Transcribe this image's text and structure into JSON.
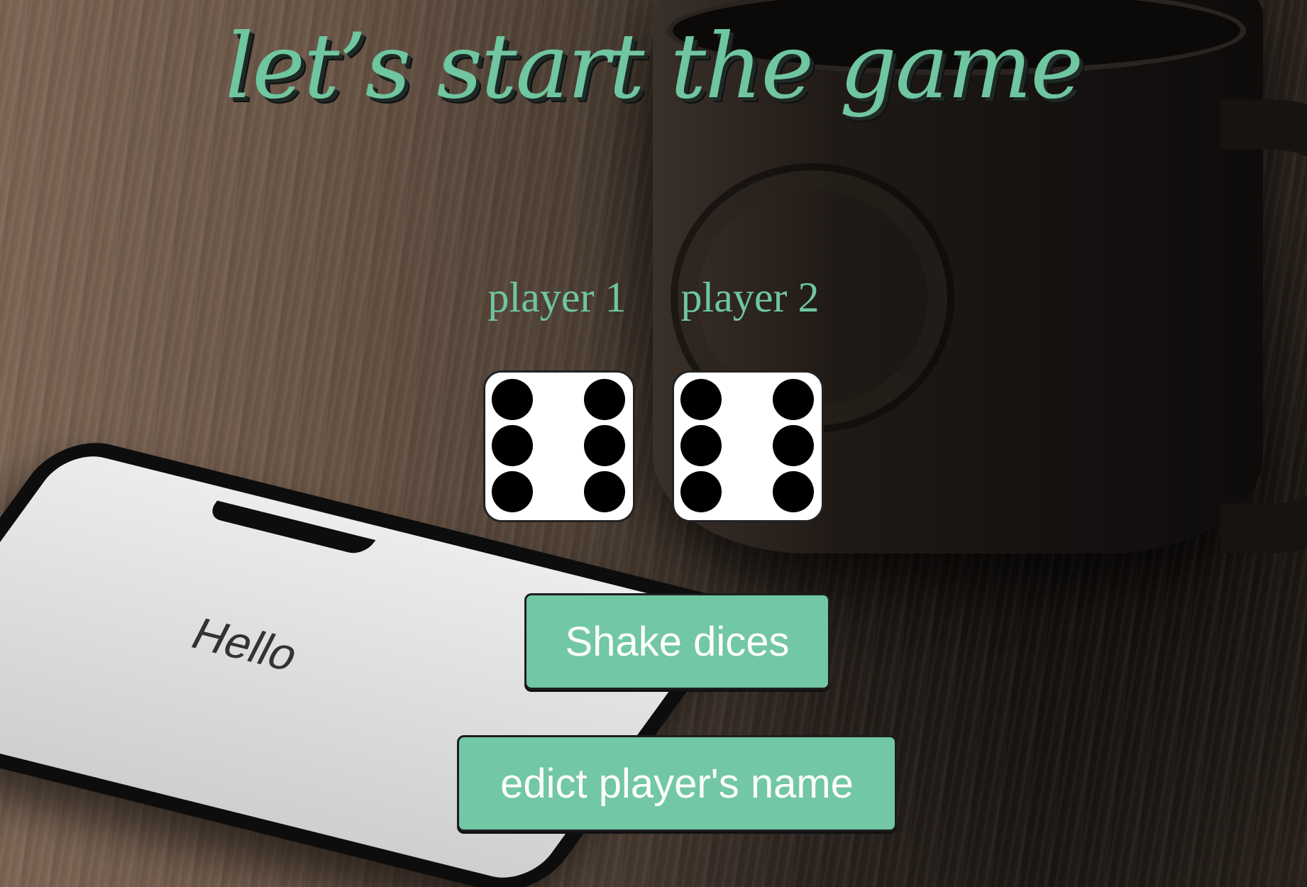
{
  "page": {
    "title": "let’s start the game"
  },
  "players": [
    {
      "label": "player 1",
      "die_value": 6
    },
    {
      "label": "player 2",
      "die_value": 6
    }
  ],
  "buttons": {
    "shake_label": "Shake dices",
    "edit_name_label": "edict player's name"
  },
  "background": {
    "phone_screen_text": "Hello"
  },
  "colors": {
    "accent": "#72c7a4",
    "title_green": "#6fc6a0",
    "pip": "#000000",
    "die_face": "#ffffff"
  }
}
